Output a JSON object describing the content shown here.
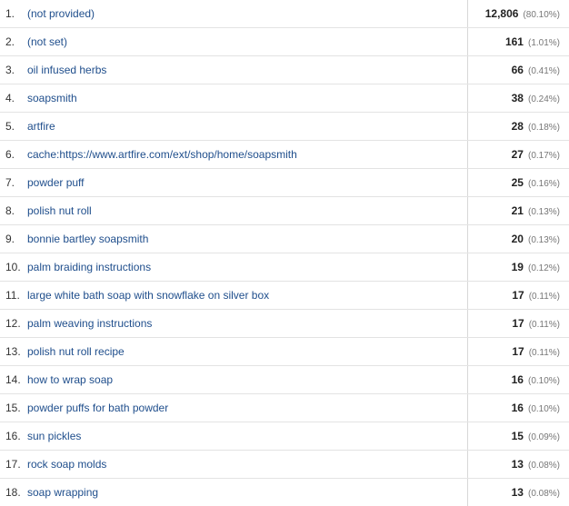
{
  "rows": [
    {
      "index": "1.",
      "keyword": "(not provided)",
      "sessions": "12,806",
      "percent": "(80.10%)"
    },
    {
      "index": "2.",
      "keyword": "(not set)",
      "sessions": "161",
      "percent": "(1.01%)"
    },
    {
      "index": "3.",
      "keyword": "oil infused herbs",
      "sessions": "66",
      "percent": "(0.41%)"
    },
    {
      "index": "4.",
      "keyword": "soapsmith",
      "sessions": "38",
      "percent": "(0.24%)"
    },
    {
      "index": "5.",
      "keyword": "artfire",
      "sessions": "28",
      "percent": "(0.18%)"
    },
    {
      "index": "6.",
      "keyword": "cache:https://www.artfire.com/ext/shop/home/soapsmith",
      "sessions": "27",
      "percent": "(0.17%)"
    },
    {
      "index": "7.",
      "keyword": "powder puff",
      "sessions": "25",
      "percent": "(0.16%)"
    },
    {
      "index": "8.",
      "keyword": "polish nut roll",
      "sessions": "21",
      "percent": "(0.13%)"
    },
    {
      "index": "9.",
      "keyword": "bonnie bartley soapsmith",
      "sessions": "20",
      "percent": "(0.13%)"
    },
    {
      "index": "10.",
      "keyword": "palm braiding instructions",
      "sessions": "19",
      "percent": "(0.12%)"
    },
    {
      "index": "11.",
      "keyword": "large white bath soap with snowflake on silver box",
      "sessions": "17",
      "percent": "(0.11%)"
    },
    {
      "index": "12.",
      "keyword": "palm weaving instructions",
      "sessions": "17",
      "percent": "(0.11%)"
    },
    {
      "index": "13.",
      "keyword": "polish nut roll recipe",
      "sessions": "17",
      "percent": "(0.11%)"
    },
    {
      "index": "14.",
      "keyword": "how to wrap soap",
      "sessions": "16",
      "percent": "(0.10%)"
    },
    {
      "index": "15.",
      "keyword": "powder puffs for bath powder",
      "sessions": "16",
      "percent": "(0.10%)"
    },
    {
      "index": "16.",
      "keyword": "sun pickles",
      "sessions": "15",
      "percent": "(0.09%)"
    },
    {
      "index": "17.",
      "keyword": "rock soap molds",
      "sessions": "13",
      "percent": "(0.08%)"
    },
    {
      "index": "18.",
      "keyword": "soap wrapping",
      "sessions": "13",
      "percent": "(0.08%)"
    }
  ],
  "colors": {
    "link": "#1f4e8c",
    "value": "#222222",
    "percent": "#777777",
    "row_border": "#e3e3e3"
  }
}
